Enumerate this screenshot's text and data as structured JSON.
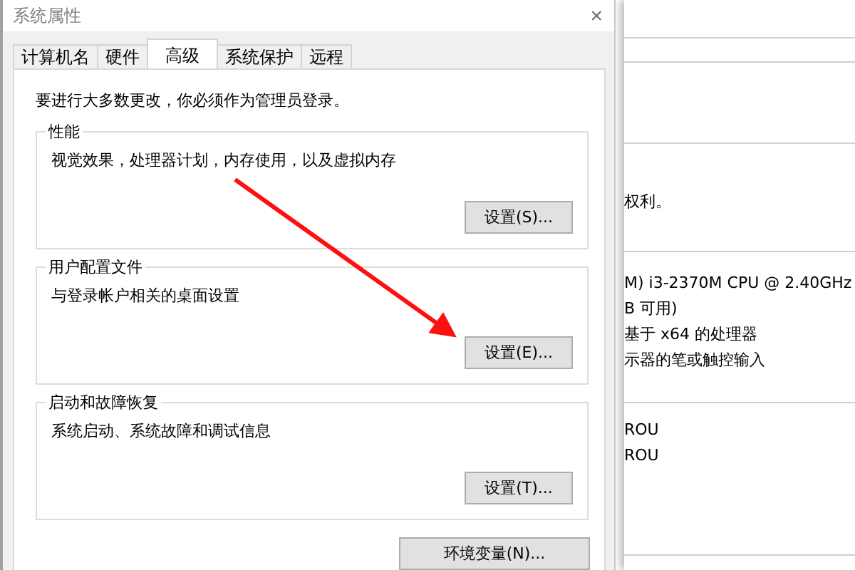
{
  "background_window": {
    "lines": [
      {
        "text": "权利。"
      },
      {
        "text": "M) i3-2370M CPU @ 2.40GHz"
      },
      {
        "text": "B 可用)"
      },
      {
        "text": "基于 x64 的处理器"
      },
      {
        "text": "示器的笔或触控输入"
      },
      {
        "text": "ROU"
      },
      {
        "text": "ROU"
      }
    ]
  },
  "window": {
    "title": "系统属性",
    "close": "×"
  },
  "tabs": [
    {
      "label": "计算机名",
      "selected": false
    },
    {
      "label": "硬件",
      "selected": false
    },
    {
      "label": "高级",
      "selected": true
    },
    {
      "label": "系统保护",
      "selected": false
    },
    {
      "label": "远程",
      "selected": false
    }
  ],
  "notice": "要进行大多数更改，你必须作为管理员登录。",
  "groups": [
    {
      "title": "性能",
      "description": "视觉效果，处理器计划，内存使用，以及虚拟内存",
      "button": "设置(S)..."
    },
    {
      "title": "用户配置文件",
      "description": "与登录帐户相关的桌面设置",
      "button": "设置(E)..."
    },
    {
      "title": "启动和故障恢复",
      "description": "系统启动、系统故障和调试信息",
      "button": "设置(T)..."
    }
  ],
  "env_button": "环境变量(N)..."
}
